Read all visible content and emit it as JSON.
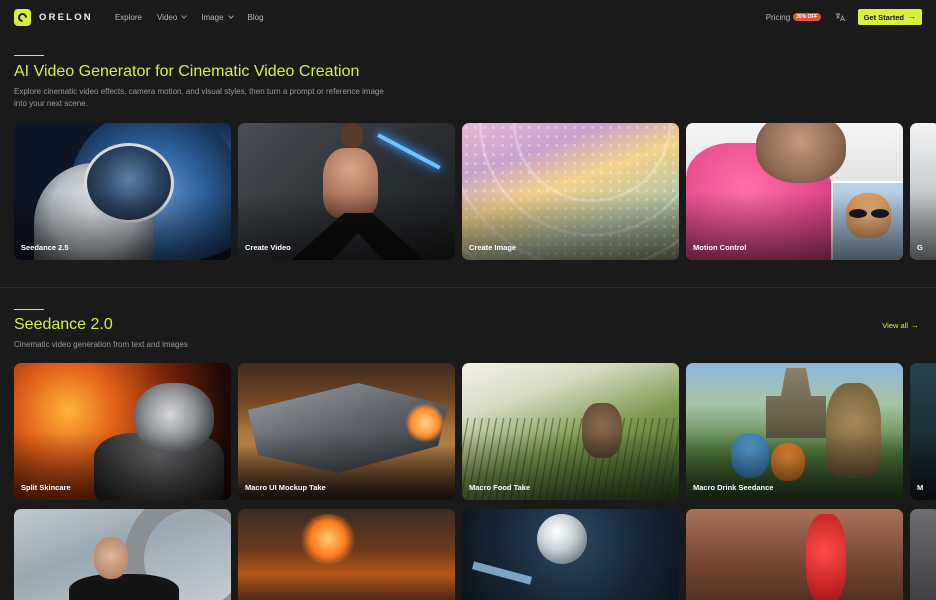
{
  "brand": {
    "name": "ORELON"
  },
  "nav": {
    "links": [
      {
        "label": "Explore",
        "has_dropdown": false
      },
      {
        "label": "Video",
        "has_dropdown": true
      },
      {
        "label": "Image",
        "has_dropdown": true
      },
      {
        "label": "Blog",
        "has_dropdown": false
      }
    ],
    "pricing_label": "Pricing",
    "pricing_badge": "30% OFF",
    "cta_label": "Get Started"
  },
  "hero": {
    "title": "AI Video Generator for Cinematic Video Creation",
    "description": "Explore cinematic video effects, camera motion, and visual styles, then turn a prompt or reference image into your next scene.",
    "cards": [
      {
        "label": "Seedance 2.5"
      },
      {
        "label": "Create Video"
      },
      {
        "label": "Create Image"
      },
      {
        "label": "Motion Control"
      },
      {
        "label": "G"
      }
    ]
  },
  "seedance": {
    "title": "Seedance 2.0",
    "subtitle": "Cinematic video generation from text and images",
    "view_all_label": "View all",
    "cards_row1": [
      {
        "label": "Split Skincare"
      },
      {
        "label": "Macro UI Mockup Take"
      },
      {
        "label": "Macro Food Take"
      },
      {
        "label": "Macro Drink Seedance"
      },
      {
        "label": "M"
      }
    ],
    "cards_row2": [
      {
        "label": ""
      },
      {
        "label": ""
      },
      {
        "label": ""
      },
      {
        "label": ""
      },
      {
        "label": ""
      }
    ]
  },
  "colors": {
    "accent": "#d9f03a",
    "background": "#1a1a1a",
    "badge": "#e2513c"
  },
  "icons": [
    "logo-icon",
    "chevron-down-icon",
    "translate-icon",
    "arrow-right-icon"
  ]
}
